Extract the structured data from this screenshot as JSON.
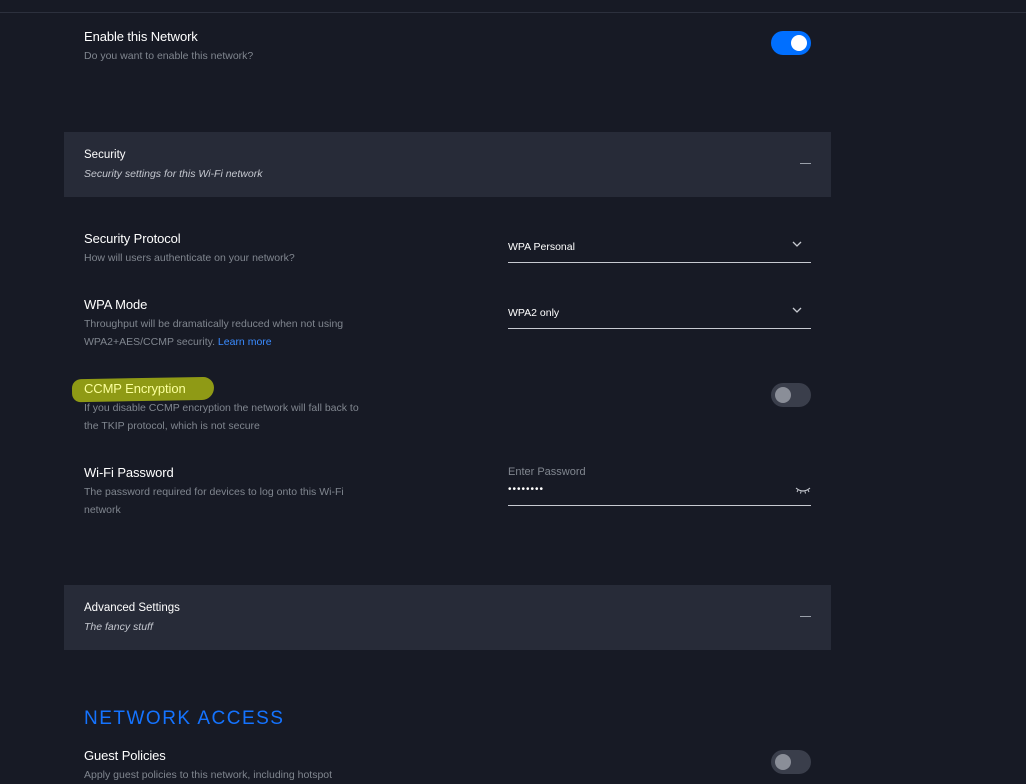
{
  "enable_network": {
    "title": "Enable this Network",
    "description": "Do you want to enable this network?",
    "enabled": true
  },
  "security_section": {
    "title": "Security",
    "subtitle": "Security settings for this Wi-Fi network"
  },
  "security_protocol": {
    "title": "Security Protocol",
    "description": "How will users authenticate on your network?",
    "value": "WPA Personal"
  },
  "wpa_mode": {
    "title": "WPA Mode",
    "description_line1": "Throughput will be dramatically reduced when not using",
    "description_line2": "WPA2+AES/CCMP security.",
    "learn_more": "Learn more",
    "value": "WPA2 only"
  },
  "ccmp": {
    "title": "CCMP Encryption",
    "description_line1": "If you disable CCMP encryption the network will fall back to",
    "description_line2": "the TKIP protocol, which is not secure",
    "enabled": false
  },
  "wifi_password": {
    "title": "Wi-Fi Password",
    "description_line1": "The password required for devices to log onto this Wi-Fi",
    "description_line2": "network",
    "placeholder": "Enter Password",
    "value": "••••••••"
  },
  "advanced_section": {
    "title": "Advanced Settings",
    "subtitle": "The fancy stuff"
  },
  "network_access": {
    "heading": "NETWORK ACCESS",
    "guest_policies": {
      "title": "Guest Policies",
      "description": "Apply guest policies to this network, including hotspot",
      "enabled": false
    }
  },
  "colors": {
    "background": "#171a25",
    "section_background": "#272b38",
    "accent": "#006fff",
    "highlight": "#8f9a15"
  },
  "icons": [
    "chevron-down-icon",
    "collapse-icon",
    "eye-closed-icon"
  ]
}
